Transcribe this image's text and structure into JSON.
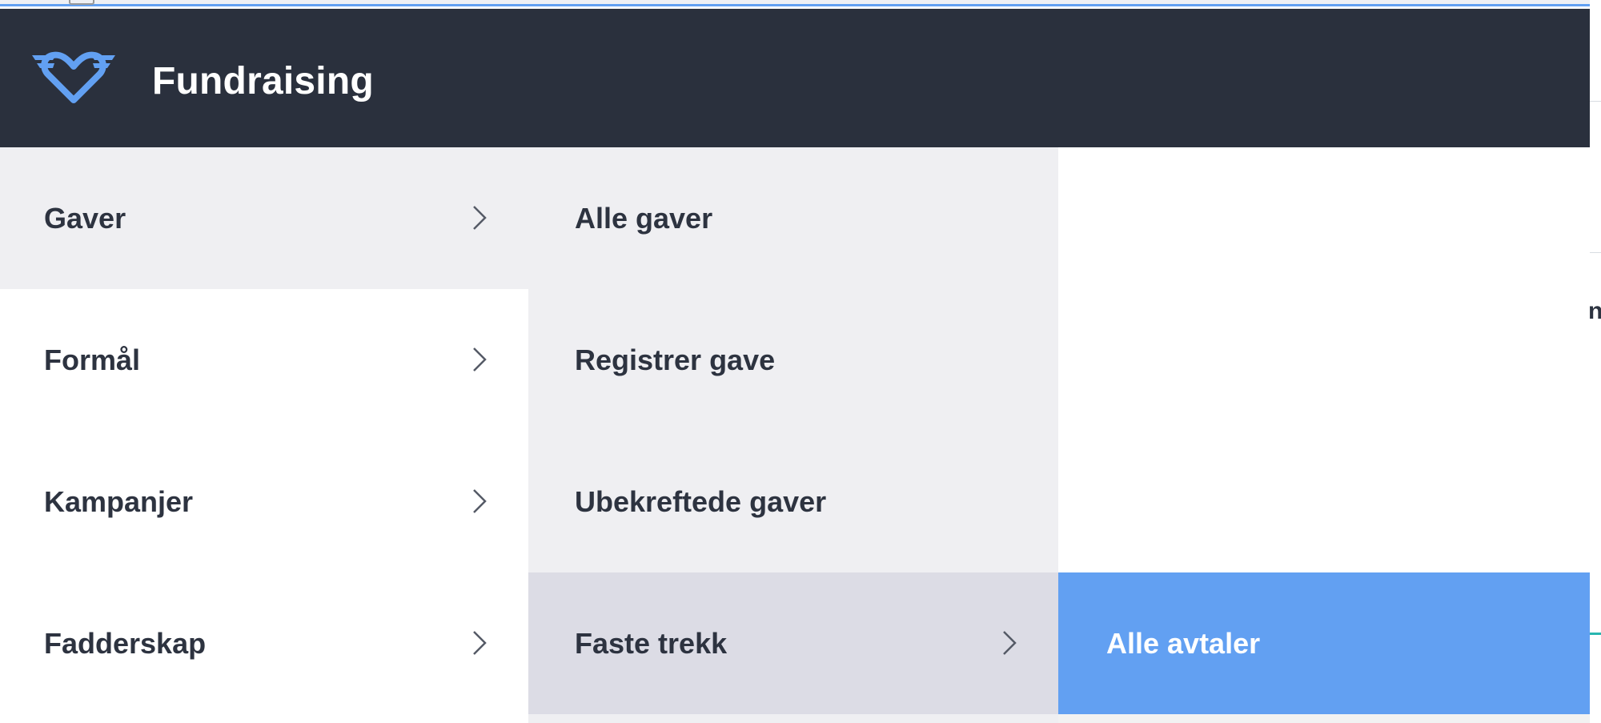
{
  "app": {
    "title": "Fundraising",
    "logo_icon": "winged-heart-icon"
  },
  "colors": {
    "header_bg": "#2a303d",
    "accent": "#62a0f2",
    "panel_bg": "#efeff2",
    "hover_bg": "#dcdce5",
    "text": "#2d3340"
  },
  "menu": {
    "level1": [
      {
        "label": "Gaver",
        "active": true
      },
      {
        "label": "Formål",
        "active": false
      },
      {
        "label": "Kampanjer",
        "active": false
      },
      {
        "label": "Fadderskap",
        "active": false
      }
    ],
    "level2": [
      {
        "label": "Alle gaver",
        "has_submenu": false
      },
      {
        "label": "Registrer gave",
        "has_submenu": false
      },
      {
        "label": "Ubekreftede gaver",
        "has_submenu": false
      },
      {
        "label": "Faste trekk",
        "has_submenu": true,
        "active": true
      }
    ],
    "level3": [
      {
        "label": "Alle avtaler",
        "selected": true
      }
    ]
  },
  "background": {
    "partial_text": "n"
  }
}
